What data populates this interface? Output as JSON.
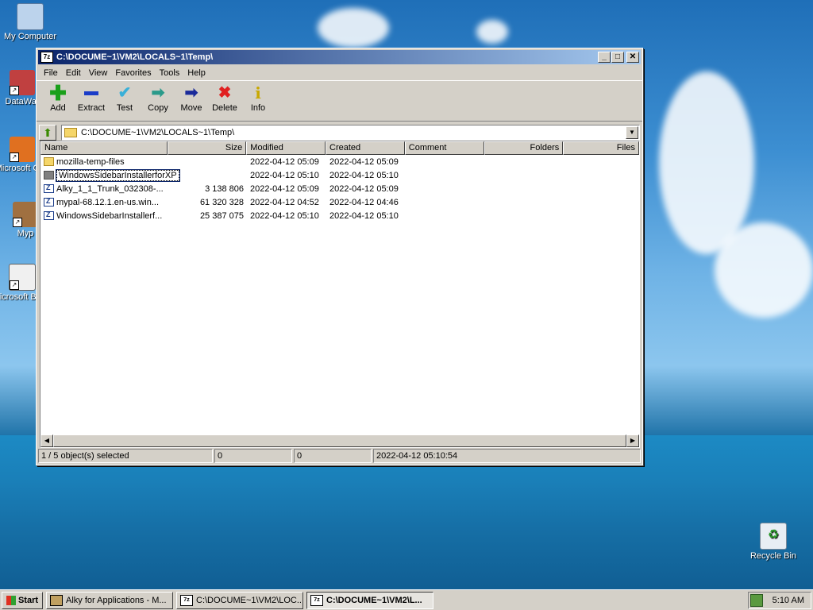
{
  "desktop": {
    "icons": [
      {
        "label": "My Computer"
      },
      {
        "label": "DataWar"
      },
      {
        "label": "Microsoft C++"
      },
      {
        "label": "Myp"
      },
      {
        "label": "Microsoft Basic"
      },
      {
        "label": "Recycle Bin"
      }
    ]
  },
  "window": {
    "app_icon": "7z",
    "title": "C:\\DOCUME~1\\VM2\\LOCALS~1\\Temp\\",
    "controls": {
      "minimize": "_",
      "maximize": "□",
      "close": "✕"
    }
  },
  "menu": [
    "File",
    "Edit",
    "View",
    "Favorites",
    "Tools",
    "Help"
  ],
  "toolbar": [
    {
      "label": "Add",
      "icon": "plus-icon",
      "color": "#1aa01a"
    },
    {
      "label": "Extract",
      "icon": "minus-icon",
      "color": "#1a3cc8"
    },
    {
      "label": "Test",
      "icon": "check-icon",
      "color": "#3ab0d8"
    },
    {
      "label": "Copy",
      "icon": "copy-arrow-icon",
      "color": "#2a9a8a"
    },
    {
      "label": "Move",
      "icon": "move-arrow-icon",
      "color": "#1a2a9a"
    },
    {
      "label": "Delete",
      "icon": "delete-x-icon",
      "color": "#e02020"
    },
    {
      "label": "Info",
      "icon": "info-icon",
      "color": "#c8a800"
    }
  ],
  "address": {
    "path": "C:\\DOCUME~1\\VM2\\LOCALS~1\\Temp\\"
  },
  "columns": [
    "Name",
    "Size",
    "Modified",
    "Created",
    "Comment",
    "Folders",
    "Files"
  ],
  "rows": [
    {
      "type": "folder",
      "name": "mozilla-temp-files",
      "size": "",
      "modified": "2022-04-12 05:09",
      "created": "2022-04-12 05:09",
      "selected": false
    },
    {
      "type": "folder-dark",
      "name": "WindowsSidebarInstallerforXP",
      "size": "",
      "modified": "2022-04-12 05:10",
      "created": "2022-04-12 05:10",
      "selected": true
    },
    {
      "type": "archive",
      "name": "Alky_1_1_Trunk_032308-...",
      "size": "3 138 806",
      "modified": "2022-04-12 05:09",
      "created": "2022-04-12 05:09",
      "selected": false
    },
    {
      "type": "archive",
      "name": "mypal-68.12.1.en-us.win...",
      "size": "61 320 328",
      "modified": "2022-04-12 04:52",
      "created": "2022-04-12 04:46",
      "selected": false
    },
    {
      "type": "archive",
      "name": "WindowsSidebarInstallerf...",
      "size": "25 387 075",
      "modified": "2022-04-12 05:10",
      "created": "2022-04-12 05:10",
      "selected": false
    }
  ],
  "status": {
    "selection": "1 / 5 object(s) selected",
    "size": "0",
    "packed": "0",
    "date": "2022-04-12 05:10:54"
  },
  "taskbar": {
    "start": "Start",
    "tasks": [
      {
        "label": "Alky for Applications - M...",
        "active": false
      },
      {
        "label": "C:\\DOCUME~1\\VM2\\LOC...",
        "active": false
      },
      {
        "label": "C:\\DOCUME~1\\VM2\\L...",
        "active": true
      }
    ],
    "clock": "5:10 AM"
  }
}
